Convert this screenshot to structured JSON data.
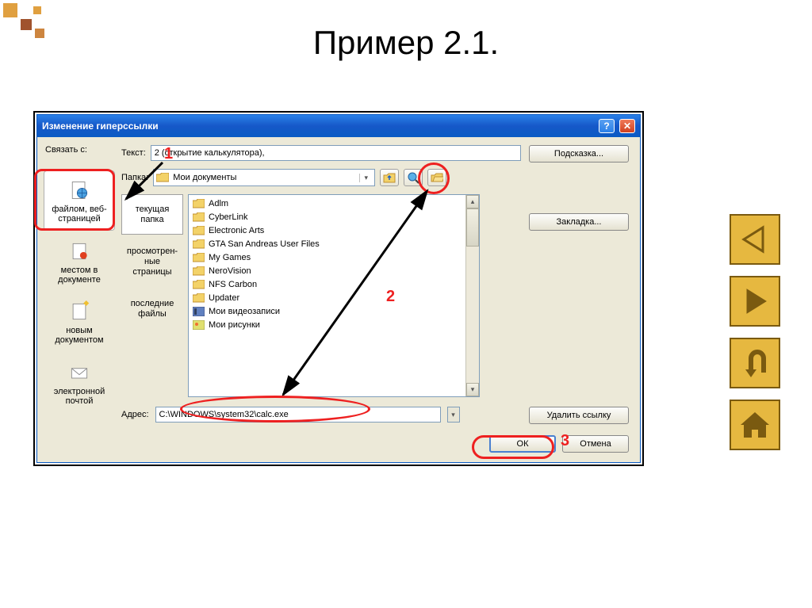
{
  "slide": {
    "title": "Пример 2.1."
  },
  "dialog": {
    "title": "Изменение гиперссылки",
    "labels": {
      "link_with": "Связать с:",
      "text": "Текст:",
      "folder": "Папка:",
      "address": "Адрес:"
    },
    "text_value": "2 (открытие калькулятора),",
    "folder_value": "Мои документы",
    "address_value": "C:\\WINDOWS\\system32\\calc.exe",
    "link_targets": [
      "файлом, веб-страницей",
      "местом в документе",
      "новым документом",
      "электронной почтой"
    ],
    "nav_tabs": [
      "текущая папка",
      "просмотрен-ные страницы",
      "последние файлы"
    ],
    "files": [
      "Adlm",
      "CyberLink",
      "Electronic Arts",
      "GTA San Andreas User Files",
      "My Games",
      "NeroVision",
      "NFS Carbon",
      "Updater",
      "Мои видеозаписи",
      "Мои рисунки"
    ],
    "buttons": {
      "hint": "Подсказка...",
      "bookmark": "Закладка...",
      "remove": "Удалить ссылку",
      "ok": "ОК",
      "cancel": "Отмена"
    }
  },
  "annotations": {
    "n1": "1",
    "n2": "2",
    "n3": "3"
  }
}
